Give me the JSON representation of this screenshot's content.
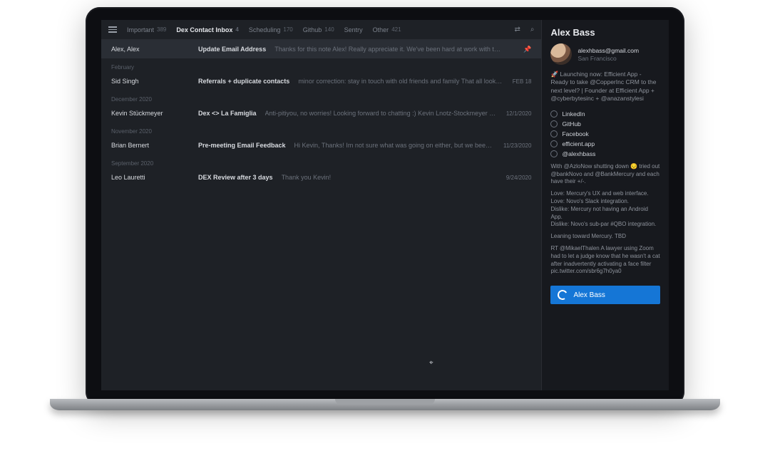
{
  "tabs": [
    {
      "label": "Important",
      "count": "389"
    },
    {
      "label": "Dex Contact Inbox",
      "count": "4",
      "active": true
    },
    {
      "label": "Scheduling",
      "count": "170"
    },
    {
      "label": "Github",
      "count": "140"
    },
    {
      "label": "Sentry",
      "count": ""
    },
    {
      "label": "Other",
      "count": "421"
    }
  ],
  "selected": {
    "sender": "Alex, Alex",
    "subject": "Update Email Address",
    "preview": "Thanks for this note Alex! Really appreciate it. We've been hard at work with the onboard…",
    "date": "",
    "pinned": true
  },
  "groups": [
    {
      "label": "February",
      "rows": [
        {
          "sender": "Sid Singh",
          "subject": "Referrals + duplicate contacts",
          "preview": "minor correction: stay in touch with old friends and family That all looks helpful, …",
          "date": "FEB 18"
        }
      ]
    },
    {
      "label": "December 2020",
      "rows": [
        {
          "sender": "Kevin Stückmeyer",
          "subject": "Dex <> La Famiglia",
          "preview": "Anti-pitiyou, no worries! Looking forward to chatting :) Kevin Lnotz-Stockmeyer mult kevin@lafa…",
          "date": "12/1/2020"
        }
      ]
    },
    {
      "label": "November 2020",
      "rows": [
        {
          "sender": "Brian Bernert",
          "subject": "Pre-meeting Email Feedback",
          "preview": "Hi Kevin, Thanks! Im not sure what was going on either, but we been getting those em…",
          "date": "11/23/2020"
        }
      ]
    },
    {
      "label": "September 2020",
      "rows": [
        {
          "sender": "Leo Lauretti",
          "subject": "DEX Review after 3 days",
          "preview": "Thank you Kevin!",
          "date": "9/24/2020"
        }
      ]
    }
  ],
  "contact": {
    "name": "Alex Bass",
    "email": "alexhbass@gmail.com",
    "location": "San Francisco",
    "bio": "🚀 Launching now: Efficient App - Ready to take @CopperInc CRM to the next level? | Founder at Efficient App + @cyberbytesinc + @anazanstylesi",
    "links": [
      {
        "label": "LinkedIn"
      },
      {
        "label": "GitHub"
      },
      {
        "label": "Facebook"
      },
      {
        "label": "efficient.app"
      },
      {
        "label": "@alexhbass"
      }
    ],
    "notes": [
      "With @AzloNow shutting down 😔 tried out @bankNovo and @BankMercury and each have their +/-.",
      "Love: Mercury's UX and web interface.\nLove: Novo's Slack integration.\nDislike: Mercury not having an Android App.\nDislike: Novo's sub-par #QBO integration.",
      "Leaning toward Mercury. TBD",
      "RT @MikaelThalen A lawyer using Zoom had to let a judge know that he wasn't a cat after inadvertently activating a face filter pic.twitter.com/sbr6g7h0ya0"
    ],
    "cta_label": "Alex Bass"
  }
}
